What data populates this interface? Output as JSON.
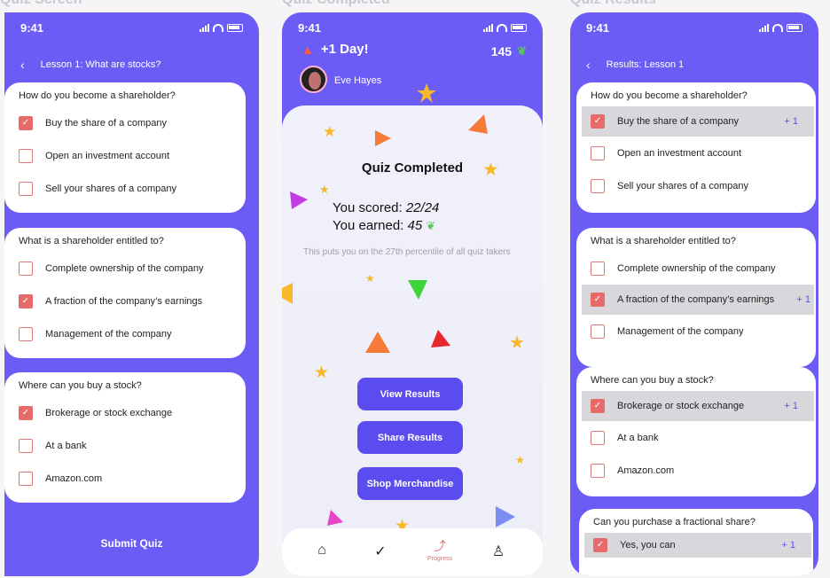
{
  "labels": {
    "screen1": "Quiz Screen",
    "screen2": "Quiz Completed",
    "screen3": "Quiz Results"
  },
  "status": {
    "time": "9:41"
  },
  "quiz": {
    "nav_title": "Lesson 1: What are stocks?",
    "questions": [
      {
        "q": "How do you become a shareholder?",
        "options": [
          "Buy the share of a company",
          "Open an investment account",
          "Sell your shares of a company"
        ],
        "checked": 0
      },
      {
        "q": "What is a shareholder entitled to?",
        "options": [
          "Complete ownership of the company",
          "A fraction of the company’s earnings",
          "Management of the company"
        ],
        "checked": 1
      },
      {
        "q": "Where can you buy a stock?",
        "options": [
          "Brokerage or stock exchange",
          "At a bank",
          "Amazon.com"
        ],
        "checked": 0
      }
    ],
    "submit_label": "Submit Quiz"
  },
  "completed": {
    "streak": "+1 Day!",
    "coins": "145",
    "user_name": "Eve Hayes",
    "title": "Quiz Completed",
    "score_prefix": "You scored: ",
    "score_value": "22/24",
    "earned_prefix": "You earned: ",
    "earned_value": "45",
    "percentile_text": "This puts you on the 27th percentile of all quiz takers",
    "buttons": [
      "View Results",
      "Share Results",
      "Shop Merchandise"
    ],
    "tab_progress_label": "Progress"
  },
  "results": {
    "nav_title": "Results: Lesson 1",
    "points": "+ 1",
    "points_tight": "+ 1",
    "questions": [
      {
        "q": "How do you become a shareholder?",
        "options": [
          "Buy the share of a company",
          "Open an investment account",
          "Sell your shares of a company"
        ],
        "checked": 0
      },
      {
        "q": "What is a shareholder entitled to?",
        "options": [
          "Complete ownership of the company",
          "A fraction of the company’s earnings",
          "Management of the company"
        ],
        "checked": 1
      },
      {
        "q": "Where can you buy a stock?",
        "options": [
          "Brokerage or stock exchange",
          "At a bank",
          "Amazon.com"
        ],
        "checked": 0
      },
      {
        "q": "Can you purchase a fractional share?",
        "options": [
          "Yes, you can"
        ],
        "checked": 0
      }
    ]
  },
  "colors": {
    "brand": "#6b5cf6",
    "button": "#5b4cf0",
    "check": "#e86b6b"
  },
  "icons": [
    "back-arrow-icon",
    "signal-icon",
    "wifi-icon",
    "battery-icon",
    "flame-icon",
    "sprout-icon",
    "home-icon",
    "check-icon",
    "progress-icon",
    "profile-icon"
  ]
}
